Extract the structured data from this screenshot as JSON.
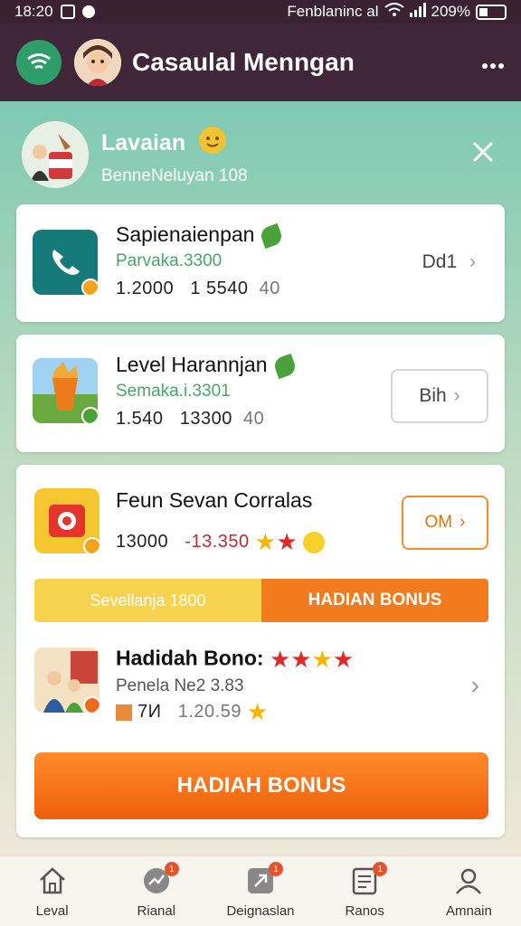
{
  "status_bar": {
    "time": "18:20",
    "carrier": "Fenblaninc al",
    "battery": "209%"
  },
  "app_bar": {
    "title": "Casaulal Menngan",
    "menu_icon": "wifi-menu-icon",
    "more_icon": "more-dots-icon"
  },
  "profile": {
    "name": "Lavaian",
    "subtitle": "BenneNeluyan 108"
  },
  "tasks": [
    {
      "title": "Sapienaienpan",
      "subtitle": "Parvaka.3300",
      "stat_1": "1.2000",
      "stat_2": "1 5540",
      "stat_3": "40",
      "action_label": "Dd1"
    },
    {
      "title": "Level Harannjan",
      "subtitle": "Semaka.i.3301",
      "stat_1": "1.540",
      "stat_2": "13300",
      "stat_3": "40",
      "action_label": "Bih"
    },
    {
      "title": "Feun Sevan Corralas",
      "stat_1": "13000",
      "stat_2": "-13.350",
      "action_label": "ОМ",
      "progress": {
        "fraction": 0.5,
        "left_label": "Sevellanja 1800",
        "right_label": "HADIAN BONUS"
      }
    },
    {
      "title": "Hadidah Bono:",
      "subtitle": "Penela Ne2 3.83",
      "stat_1": "7И",
      "stat_2": "1.20.59",
      "stars_red": 3,
      "stars_gold": 1
    }
  ],
  "primary_button": "HADIAH BONUS",
  "bottom_nav": [
    {
      "label": "Leval",
      "icon": "home-icon",
      "badge": ""
    },
    {
      "label": "Rianal",
      "icon": "chart-icon",
      "badge": "1"
    },
    {
      "label": "Deignaslan",
      "icon": "arrow-box-icon",
      "badge": "1"
    },
    {
      "label": "Ranos",
      "icon": "document-icon",
      "badge": "1"
    },
    {
      "label": "Amnain",
      "icon": "person-icon",
      "badge": ""
    }
  ],
  "colors": {
    "header": "#3f2638",
    "accent_orange": "#f27c1d",
    "green": "#2f9d6a"
  }
}
